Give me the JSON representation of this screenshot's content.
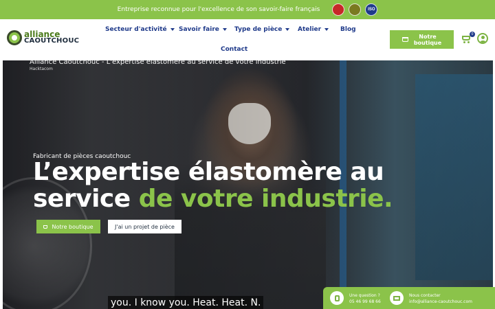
{
  "topbar": {
    "text": "Entreprise reconnue pour l'excellence de son savoir-faire français",
    "certifications": [
      {
        "icon": "ept-label-badge-icon",
        "label": ""
      },
      {
        "icon": "quality-seal-badge-icon",
        "label": ""
      },
      {
        "icon": "iso-badge-icon",
        "label": "ISO"
      }
    ],
    "colors": {
      "background": "#8bc34a"
    }
  },
  "logo": {
    "line1": "alliance",
    "line2": "CAOUTCHOUC",
    "icon": "alliance-caoutchouc-logo"
  },
  "nav": {
    "items": [
      {
        "label": "Secteur d'activité",
        "has_dropdown": true
      },
      {
        "label": "Savoir faire",
        "has_dropdown": true
      },
      {
        "label": "Type de pièce",
        "has_dropdown": true
      },
      {
        "label": "Atelier",
        "has_dropdown": true
      },
      {
        "label": "Blog",
        "has_dropdown": false
      },
      {
        "label": "Contact",
        "has_dropdown": false
      }
    ],
    "shop_button": {
      "line1": "Notre",
      "line2": "boutique",
      "icon": "cart-icon"
    },
    "cart": {
      "icon": "cart-icon",
      "count": "0"
    },
    "account": {
      "icon": "user-icon"
    }
  },
  "video": {
    "title": "Alliance Caoutchouc - L'expertise élastomère au service de votre industrie",
    "channel": "Hacktacom",
    "caption": "you. I know you. Heat. Heat. N."
  },
  "hero": {
    "eyebrow": "Fabricant de pièces caoutchouc",
    "headline_white_1": "L’expertise élastomère au",
    "headline_white_2": "service ",
    "headline_green": "de votre industrie.",
    "primary_button": "Notre boutique",
    "secondary_button": "J'ai un projet de pièce"
  },
  "contact": {
    "phone_label": "Une question ?",
    "phone_value": "05 46 99 68 66",
    "email_label": "Nous contacter",
    "email_value": "info@alliance-caoutchouc.com"
  },
  "colors": {
    "accent": "#8bc34a",
    "nav_text": "#1f3a8a"
  }
}
